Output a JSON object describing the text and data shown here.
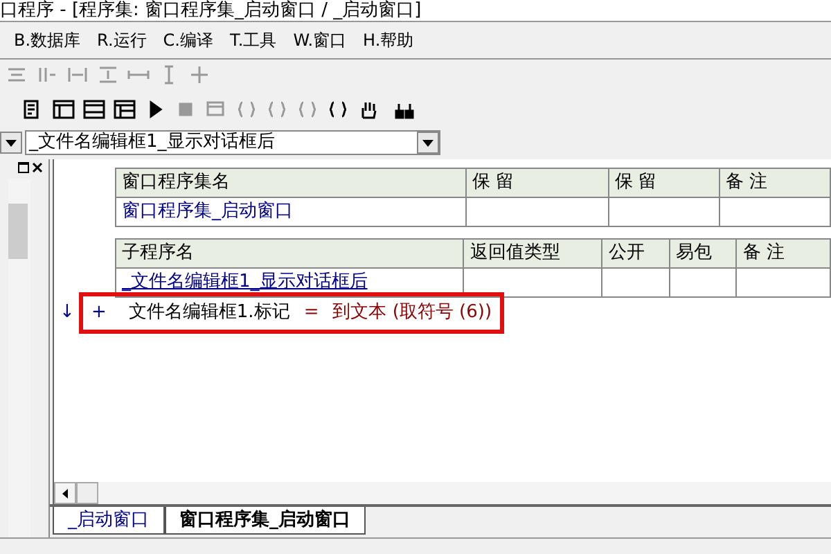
{
  "window": {
    "title": "口程序 - [程序集: 窗口程序集_启动窗口 / _启动窗口]"
  },
  "menu": [
    "B.数据库",
    "R.运行",
    "C.编译",
    "T.工具",
    "W.窗口",
    "H.帮助"
  ],
  "subroutine_select": {
    "value": "_文件名编辑框1_显示对话框后"
  },
  "assembly_table": {
    "columns": [
      "窗口程序集名",
      "保 留",
      "保 留",
      "备 注"
    ],
    "rows": [
      [
        "窗口程序集_启动窗口",
        "",
        "",
        ""
      ]
    ]
  },
  "sub_table": {
    "columns": [
      "子程序名",
      "返回值类型",
      "公开",
      "易包",
      "备 注"
    ],
    "rows": [
      [
        "_文件名编辑框1_显示对话框后",
        "",
        "",
        "",
        ""
      ]
    ]
  },
  "code_line": {
    "arrow": "↓",
    "plus": "+",
    "target": "文件名编辑框1.标记",
    "op": "=",
    "call": "到文本 (取符号 (6))",
    "highlighted": true
  },
  "tabs": [
    {
      "label": "_启动窗口",
      "selected": false
    },
    {
      "label": "窗口程序集_启动窗口",
      "selected": true
    }
  ]
}
